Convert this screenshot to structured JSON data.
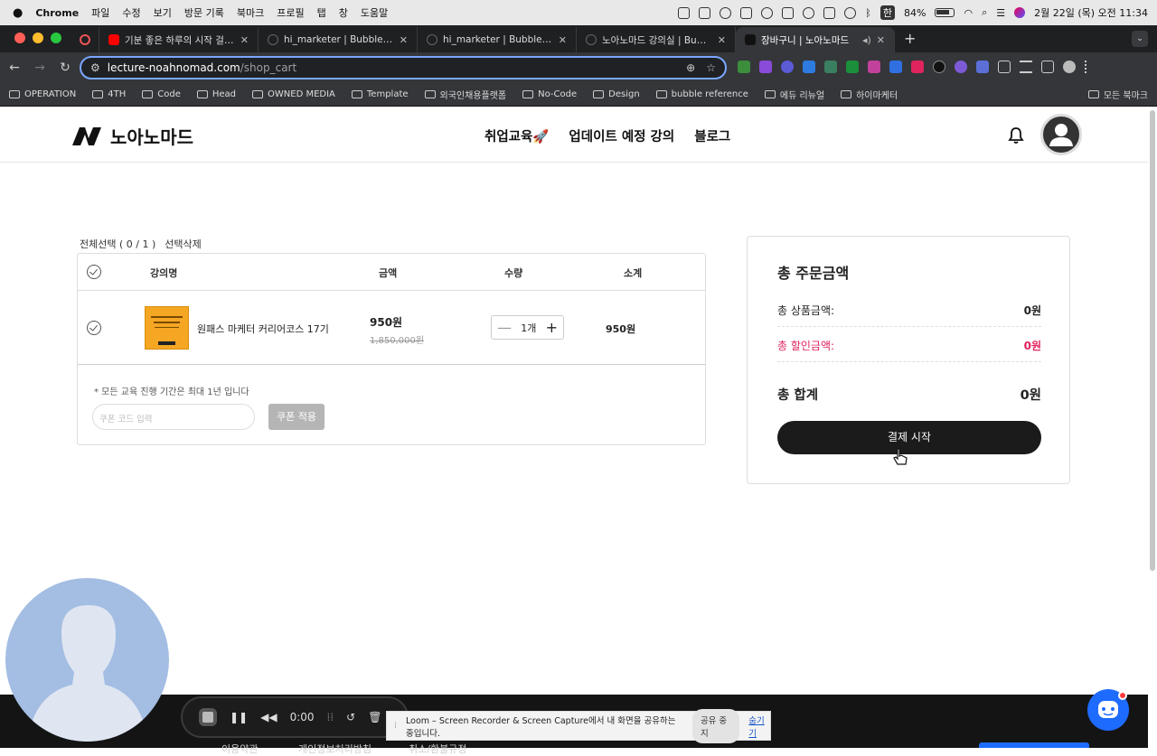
{
  "mac_menu": {
    "apple": "",
    "app": "Chrome",
    "items": [
      "파일",
      "수정",
      "보기",
      "방문 기록",
      "북마크",
      "프로필",
      "탭",
      "창",
      "도움말"
    ],
    "battery": "84%",
    "input_lang": "한",
    "datetime": "2월 22일 (목) 오전 11:34"
  },
  "tabs": [
    {
      "title": "기분 좋은 하루의 시작 걸그룹 ♬♡",
      "favicon_color": "#ff0000"
    },
    {
      "title": "hi_marketer | Bubble Editor",
      "favicon_color": "#2a2a2a"
    },
    {
      "title": "hi_marketer | Bubble Editor",
      "favicon_color": "#2a2a2a"
    },
    {
      "title": "노아노마드 강의실 | Bubble Edito",
      "favicon_color": "#2a2a2a"
    },
    {
      "title": "장바구니 | 노아노마드",
      "favicon_color": "#2a2a2a",
      "active": true
    }
  ],
  "address": {
    "host": "lecture-noahnomad.com",
    "path": "/shop_cart"
  },
  "bookmarks": [
    "OPERATION",
    "4TH",
    "Code",
    "Head",
    "OWNED MEDIA",
    "Template",
    "외국인채용플랫폼",
    "No-Code",
    "Design",
    "bubble reference",
    "에듀 리뉴얼",
    "하이마케터"
  ],
  "bookmarks_right": "모든 북마크",
  "site": {
    "logo": "노아노마드",
    "nav": [
      "취업교육🚀",
      "업데이트 예정 강의",
      "블로그"
    ]
  },
  "cart": {
    "select_all": "전체선택 ( 0 / 1 )",
    "delete_selected": "선택삭제",
    "headers": {
      "name": "강의명",
      "price": "금액",
      "qty": "수량",
      "subtotal": "소계"
    },
    "item": {
      "name": "원패스 마케터 커리어코스 17기",
      "price": "950원",
      "original_price": "1,850,000원",
      "qty": "1개",
      "minus": "—",
      "plus": "+",
      "subtotal": "950원"
    },
    "notice": "* 모든 교육 진행 기간은 최대 1년 입니다",
    "coupon_placeholder": "쿠폰 코드 입력",
    "coupon_apply": "쿠폰 적용"
  },
  "summary": {
    "title": "총 주문금액",
    "product_label": "총 상품금액:",
    "product_value": "0원",
    "discount_label": "총 할인금액:",
    "discount_value": "0원",
    "total_label": "총 합계",
    "total_value": "0원",
    "pay_button": "결제 시작",
    "discount_color": "#e0245e"
  },
  "loom": {
    "time": "0:00",
    "share_text": "Loom – Screen Recorder & Screen Capture에서 내 화면을 공유하는 중입니다.",
    "stop_share": "공유 중지",
    "hide": "숨기기"
  },
  "footer": [
    "이용약관",
    "개인정보처리방침",
    "취소/환불규정"
  ]
}
